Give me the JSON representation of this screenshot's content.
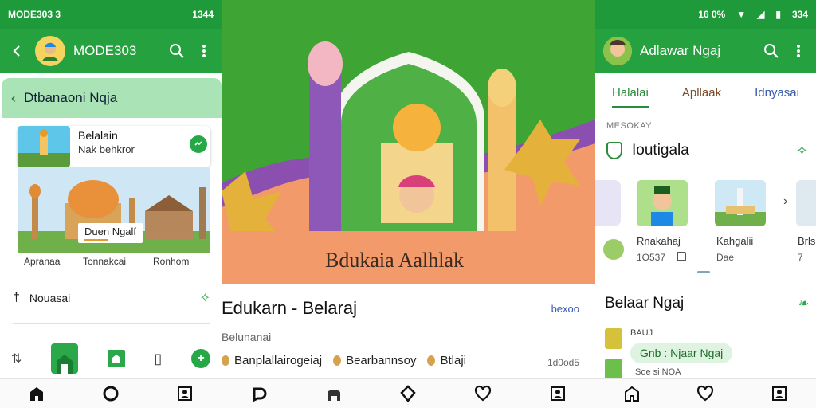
{
  "left": {
    "status": {
      "left_text": "MODE303 3",
      "right_text": "1344"
    },
    "appbar": {
      "title": "MODE303"
    },
    "header": {
      "title": "Dtbanaoni Nqja"
    },
    "card": {
      "title": "Belalain",
      "subtitle": "Nak behkror"
    },
    "gallery": {
      "badge": "Duen Ngalf",
      "captions": [
        "Apranaa",
        "Tonnakcai",
        "Ronhom"
      ]
    },
    "row1": {
      "label": "Nouasai"
    },
    "bottom_nav": [
      "home-icon",
      "chat-icon",
      "profile-icon"
    ]
  },
  "mid": {
    "hero": {
      "banner_text": "Bdukaia Aalhlak"
    },
    "title": "Edukarn - Belaraj",
    "link": "bexoo",
    "subtitle": "Belunanai",
    "tags": [
      "Banplallairogeiaj",
      "Bearbannsoy",
      "Btlaji"
    ],
    "time": "1d0od5"
  },
  "right": {
    "status": {
      "left_text": "16 0%",
      "right_text": "334"
    },
    "appbar": {
      "title": "Adlawar Ngaj"
    },
    "tabs": [
      "Halalai",
      "Apllaak",
      "Idnyasai"
    ],
    "section": "MESOKAY",
    "heading": "Ioutigala",
    "items": [
      {
        "name": "Rnakahaj",
        "meta": "1O537"
      },
      {
        "name": "Kahgalii",
        "meta": "Dae"
      },
      {
        "name": "Brls",
        "meta": "7"
      }
    ],
    "heading2": "Belaar Ngaj",
    "badge": "BAUJ",
    "chip": "Gnb : Njaar Ngaj",
    "footnote": "Soe si NOA"
  },
  "colors": {
    "brand_green": "#26a13f",
    "accent_green": "#2a8b3c",
    "header_mint": "#a9e3b6"
  }
}
